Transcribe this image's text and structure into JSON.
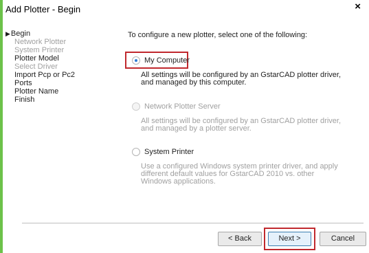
{
  "window": {
    "title": "Add Plotter - Begin",
    "close_glyph": "×"
  },
  "steps": [
    {
      "label": "Begin",
      "state": "current"
    },
    {
      "label": "Network Plotter",
      "state": "disabled"
    },
    {
      "label": "System Printer",
      "state": "disabled"
    },
    {
      "label": "Plotter Model",
      "state": "normal"
    },
    {
      "label": "Select Driver",
      "state": "disabled"
    },
    {
      "label": "Import Pcp or Pc2",
      "state": "normal"
    },
    {
      "label": "Ports",
      "state": "normal"
    },
    {
      "label": "Plotter Name",
      "state": "normal"
    },
    {
      "label": "Finish",
      "state": "normal"
    }
  ],
  "intro": "To configure a new plotter, select one of the following:",
  "options": [
    {
      "label": "My Computer",
      "checked": true,
      "enabled": true,
      "desc": [
        "All settings will be configured by an GstarCAD plotter driver,",
        "and managed by this computer."
      ]
    },
    {
      "label": "Network Plotter Server",
      "checked": false,
      "enabled": false,
      "desc": [
        "All settings will be configured by an GstarCAD plotter driver,",
        "and managed by a plotter server."
      ]
    },
    {
      "label": "System Printer",
      "checked": false,
      "enabled": true,
      "desc": [
        "Use a configured Windows system printer driver, and apply",
        "different default values for GstarCAD 2010 vs. other",
        "Windows applications."
      ]
    }
  ],
  "buttons": {
    "back": "< Back",
    "next": "Next >",
    "cancel": "Cancel"
  },
  "colors": {
    "accent_bar": "#6cc24a",
    "highlight": "#c0282d",
    "radio_dot": "#2b7bd6",
    "disabled_text": "#a0a0a0"
  }
}
